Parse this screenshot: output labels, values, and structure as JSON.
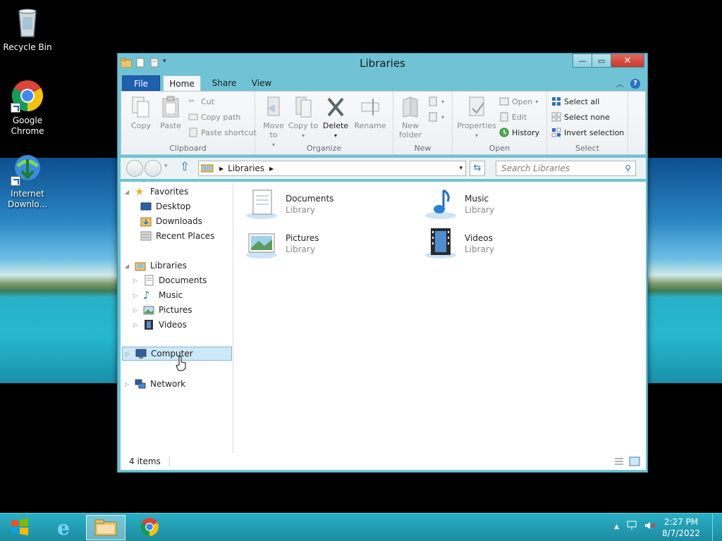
{
  "desktop": {
    "icons": [
      {
        "label": "Recycle Bin"
      },
      {
        "label": "Google Chrome"
      },
      {
        "label": "Internet Downlo..."
      }
    ]
  },
  "window": {
    "title": "Libraries",
    "tabs": {
      "file": "File",
      "home": "Home",
      "share": "Share",
      "view": "View"
    },
    "ribbon": {
      "clipboard": {
        "label": "Clipboard",
        "copy": "Copy",
        "paste": "Paste",
        "cut": "Cut",
        "copy_path": "Copy path",
        "paste_shortcut": "Paste shortcut"
      },
      "organize": {
        "label": "Organize",
        "move_to": "Move to",
        "copy_to": "Copy to",
        "delete": "Delete",
        "rename": "Rename"
      },
      "new": {
        "label": "New",
        "new_folder": "New folder"
      },
      "open": {
        "label": "Open",
        "properties": "Properties",
        "open": "Open",
        "edit": "Edit",
        "history": "History"
      },
      "select": {
        "label": "Select",
        "select_all": "Select all",
        "select_none": "Select none",
        "invert_selection": "Invert selection"
      }
    },
    "address": {
      "path": "Libraries",
      "search_placeholder": "Search Libraries"
    },
    "nav": {
      "favorites": "Favorites",
      "desktop": "Desktop",
      "downloads": "Downloads",
      "recent_places": "Recent Places",
      "libraries": "Libraries",
      "documents": "Documents",
      "music": "Music",
      "pictures": "Pictures",
      "videos": "Videos",
      "computer": "Computer",
      "network": "Network"
    },
    "items": [
      {
        "name": "Documents",
        "type": "Library"
      },
      {
        "name": "Music",
        "type": "Library"
      },
      {
        "name": "Pictures",
        "type": "Library"
      },
      {
        "name": "Videos",
        "type": "Library"
      }
    ],
    "status": "4 items"
  },
  "taskbar": {
    "time": "2:27 PM",
    "date": "8/7/2022"
  },
  "colors": {
    "accent": "#1f5fb0",
    "window_frame": "#6fc3d4",
    "taskbar": "#2bb0c6"
  }
}
